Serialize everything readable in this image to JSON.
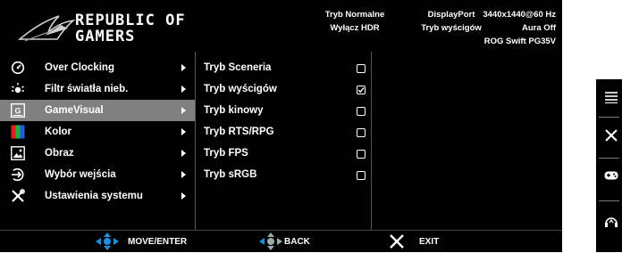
{
  "header": {
    "brand_line1": "REPUBLIC OF",
    "brand_line2": "GAMERS",
    "status": {
      "mode_line1": "Tryb Normalne",
      "mode_line2": "Wyłącz HDR",
      "input_line1": "DisplayPort",
      "input_line2": "Tryb wyścigów",
      "res_line1": "3440x1440@60 Hz",
      "res_line2": "Aura Off",
      "res_line3": "ROG Swift PG35V"
    }
  },
  "main_menu": {
    "items": [
      {
        "label": "Over Clocking",
        "icon": "speedometer-icon"
      },
      {
        "label": "Filtr światła nieb.",
        "icon": "blue-light-icon"
      },
      {
        "label": "GameVisual",
        "icon": "gamevisual-icon",
        "selected": true
      },
      {
        "label": "Kolor",
        "icon": "color-icon"
      },
      {
        "label": "Obraz",
        "icon": "image-icon"
      },
      {
        "label": "Wybór wejścia",
        "icon": "input-select-icon"
      },
      {
        "label": "Ustawienia systemu",
        "icon": "wrench-icon"
      }
    ]
  },
  "sub_menu": {
    "items": [
      {
        "label": "Tryb Sceneria",
        "checked": false
      },
      {
        "label": "Tryb wyścigów",
        "checked": true
      },
      {
        "label": "Tryb kinowy",
        "checked": false
      },
      {
        "label": "Tryb RTS/RPG",
        "checked": false
      },
      {
        "label": "Tryb FPS",
        "checked": false
      },
      {
        "label": "Tryb sRGB",
        "checked": false
      }
    ]
  },
  "footer": {
    "move_label": "MOVE/ENTER",
    "back_label": "BACK",
    "exit_label": "EXIT"
  },
  "side_keys": [
    "menu-icon",
    "close-icon",
    "gamepad-icon",
    "headphones-icon"
  ],
  "colors": {
    "background": "#000000",
    "selected_row": "#808080",
    "accent_blue": "#1f8fe0"
  }
}
